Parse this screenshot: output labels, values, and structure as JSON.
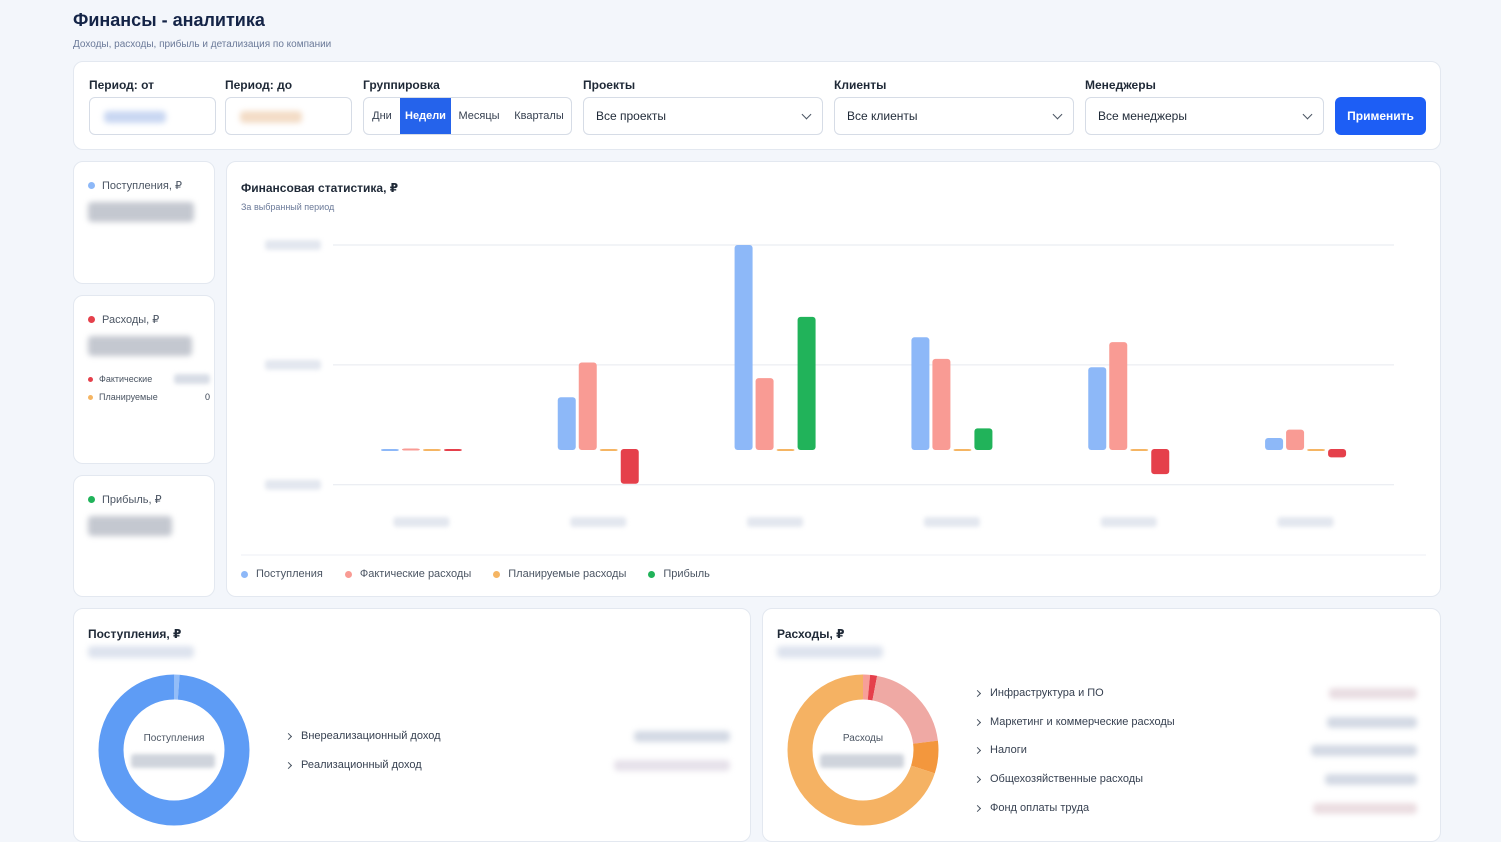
{
  "header": {
    "title": "Финансы - аналитика",
    "subtitle": "Доходы, расходы, прибыль и детализация по компании"
  },
  "filters": {
    "period_from_label": "Период: от",
    "period_to_label": "Период: до",
    "grouping_label": "Группировка",
    "grouping_options": [
      "Дни",
      "Недели",
      "Месяцы",
      "Кварталы"
    ],
    "grouping_selected": "Недели",
    "projects_label": "Проекты",
    "projects_value": "Все проекты",
    "clients_label": "Клиенты",
    "clients_value": "Все клиенты",
    "managers_label": "Менеджеры",
    "managers_value": "Все менеджеры",
    "apply_label": "Применить"
  },
  "stats": {
    "income_title": "Поступления, ₽",
    "expenses_title": "Расходы, ₽",
    "expenses_actual_label": "Фактические",
    "expenses_planned_label": "Планируемые",
    "expenses_planned_value": "0",
    "profit_title": "Прибыль, ₽"
  },
  "colors": {
    "income": "#8db8f8",
    "actual": "#f99b94",
    "planned": "#f5b563",
    "profit": "#21b35a",
    "loss": "#e5404b",
    "accent": "#1d5ef5"
  },
  "chart": {
    "title": "Финансовая статистика, ₽",
    "subtitle": "За выбранный период",
    "legend": [
      "Поступления",
      "Фактические расходы",
      "Планируемые расходы",
      "Прибыль"
    ]
  },
  "chart_data": {
    "type": "bar",
    "categories": [
      "",
      "",
      "",
      "",
      "",
      ""
    ],
    "series": [
      {
        "name": "Поступления",
        "values": [
          0.3,
          44,
          171,
          94,
          69,
          10
        ]
      },
      {
        "name": "Фактические расходы",
        "values": [
          1.2,
          73,
          60,
          76,
          90,
          17
        ]
      },
      {
        "name": "Планируемые расходы",
        "values": [
          0,
          0,
          0,
          0,
          0,
          0
        ]
      },
      {
        "name": "Прибыль",
        "values": [
          -1,
          -29,
          111,
          18,
          -21,
          -7
        ]
      }
    ],
    "ylim": [
      -29,
      171
    ]
  },
  "income_pie": {
    "title": "Поступления, ₽",
    "center_label": "Поступления",
    "categories": [
      {
        "label": "Внереализационный доход",
        "share": 0.012,
        "color": "#93bdf8"
      },
      {
        "label": "Реализационный доход",
        "share": 0.988,
        "color": "#5e9cf5"
      }
    ]
  },
  "expenses_pie": {
    "title": "Расходы, ₽",
    "center_label": "Расходы",
    "categories": [
      {
        "label": "Инфраструктура и ПО",
        "share": 0.015,
        "color": "#f79f98"
      },
      {
        "label": "Маркетинг и коммерческие расходы",
        "share": 0.015,
        "color": "#e5404b"
      },
      {
        "label": "Налоги",
        "share": 0.2,
        "color": "#efa9a4"
      },
      {
        "label": "Общехозяйственные расходы",
        "share": 0.07,
        "color": "#f3973d"
      },
      {
        "label": "Фонд оплаты труда",
        "share": 0.7,
        "color": "#f5b263"
      }
    ]
  }
}
